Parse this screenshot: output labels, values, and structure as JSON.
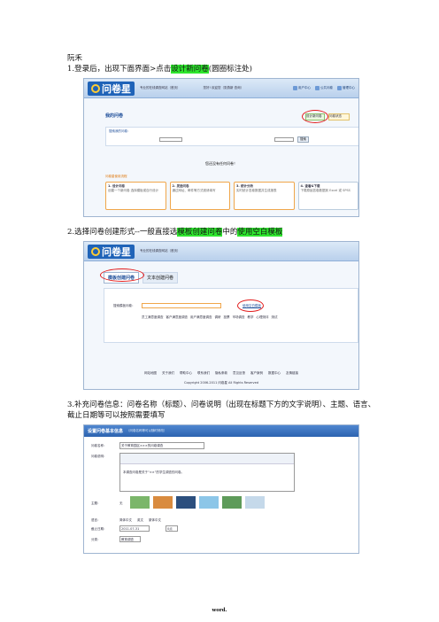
{
  "doc": {
    "author": "阮禾",
    "step1_before": "1.登录后，出现下面界面>点击",
    "step1_highlight": "设计新问卷",
    "step1_after": "(圆圈标注处)",
    "step2_before": "2.选择问卷创建形式--一般直接选",
    "step2_highlight1": "模板创建问卷",
    "step2_middle": "中的",
    "step2_highlight2": "使用空白模板",
    "step3_line1": "3.补充问卷信息：问卷名称（标题）、问卷说明（出现在标题下方的文字说明）、主题、语言、",
    "step3_line2": "截止日期等可以按照需要填写",
    "footer": "word."
  },
  "shot1": {
    "logo": "问卷星",
    "slogan": "专业的在线调查网站（首页）",
    "welcome": "您好! 欢迎您（张燕新  查询）",
    "nav": [
      "用户中心",
      "公共问卷",
      "管理中心"
    ],
    "my_surveys": "我的问卷",
    "design_new_survey": "设计新问卷",
    "survey_status_btn": "问卷状态",
    "filter_title": "搜索我的问卷：",
    "empty_notice": "您还没有任何问卷！",
    "process_title": "问卷星使用流程",
    "search_btn": "搜索",
    "steps": [
      {
        "title": "1. 设计问卷",
        "desc": "创建一个新问卷 选择模板或自行设计"
      },
      {
        "title": "2. 发送问卷",
        "desc": "通过网址、邮件等方式邀请填写"
      },
      {
        "title": "3. 统计分析",
        "desc": "实时统计答卷数据并生成报表"
      },
      {
        "title": "4. 查看&下载",
        "desc": "下载原始答卷数据到 Excel 或 SPSS"
      }
    ]
  },
  "shot2": {
    "logo": "问卷星",
    "slogan": "专业的在线调查网站（首页）",
    "tab_template": "模板创建问卷",
    "tab_text": "文本创建问卷",
    "use_blank_template": "使用空白模板",
    "template_search_label": "搜索模板问卷：",
    "categories": [
      "员工满意度调查",
      "客户满意度调查",
      "用户满意度调查",
      "调研",
      "投票",
      "市场调查",
      "教学",
      "心理测评",
      "测试"
    ],
    "footer_links": [
      "网站地图",
      "关于我们",
      "帮助中心",
      "联系我们",
      "隐私条款",
      "意见反馈",
      "客户案例",
      "数据中心",
      "友情链接"
    ],
    "copyright": "Copyright 2006-2011 问卷星 All Rights Reserved"
  },
  "shot3": {
    "header": "设置问卷基本信息",
    "header_note": "（问卷名称等可以随时修改）",
    "name_label": "问卷名称：",
    "name_value": "关于教育园区×××的问卷调查",
    "desc_label": "问卷说明：",
    "desc_value": "本调查问卷是关于“××”的学生调查的问卷。",
    "theme_label": "主题：",
    "theme_none": "无",
    "language_label": "语言：",
    "language_options": [
      "简体中文",
      "英文",
      "繁体中文"
    ],
    "deadline_label": "截止日期：",
    "deadline_value": "2011-07-31",
    "hour_value": "0点",
    "category_label": "分类：",
    "category_value": "教育调查"
  },
  "colors": {
    "highlight": "#2ee62e",
    "ring": "#e21d1d",
    "brand": "#1f63b8"
  }
}
